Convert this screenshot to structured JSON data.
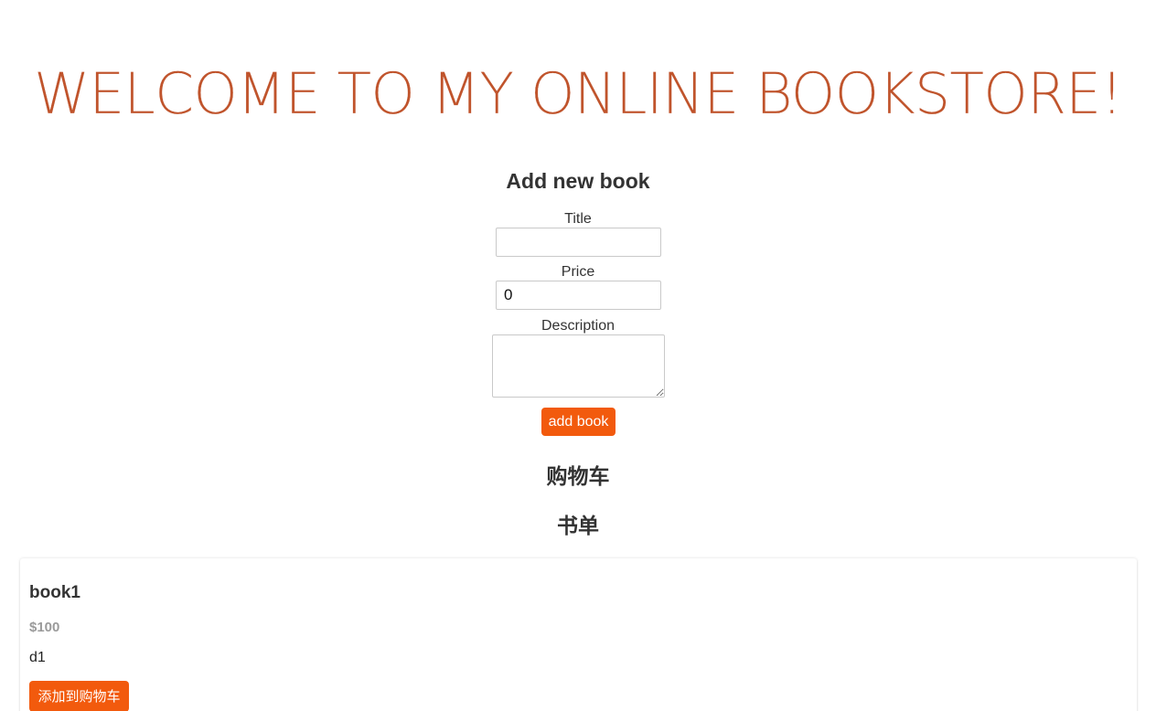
{
  "header": {
    "title": "WELCOME TO MY ONLINE BOOKSTORE!"
  },
  "add_book_form": {
    "heading": "Add new book",
    "title_label": "Title",
    "title_value": "",
    "price_label": "Price",
    "price_value": "0",
    "description_label": "Description",
    "description_value": "",
    "submit_label": "add book"
  },
  "cart": {
    "heading": "购物车"
  },
  "book_list": {
    "heading": "书单",
    "books": [
      {
        "title": "book1",
        "price": "$100",
        "description": "d1",
        "add_to_cart_label": "添加到购物车"
      }
    ]
  },
  "colors": {
    "accent": "#f25a0d",
    "title": "#c0542c",
    "price": "#9a9a9a"
  }
}
